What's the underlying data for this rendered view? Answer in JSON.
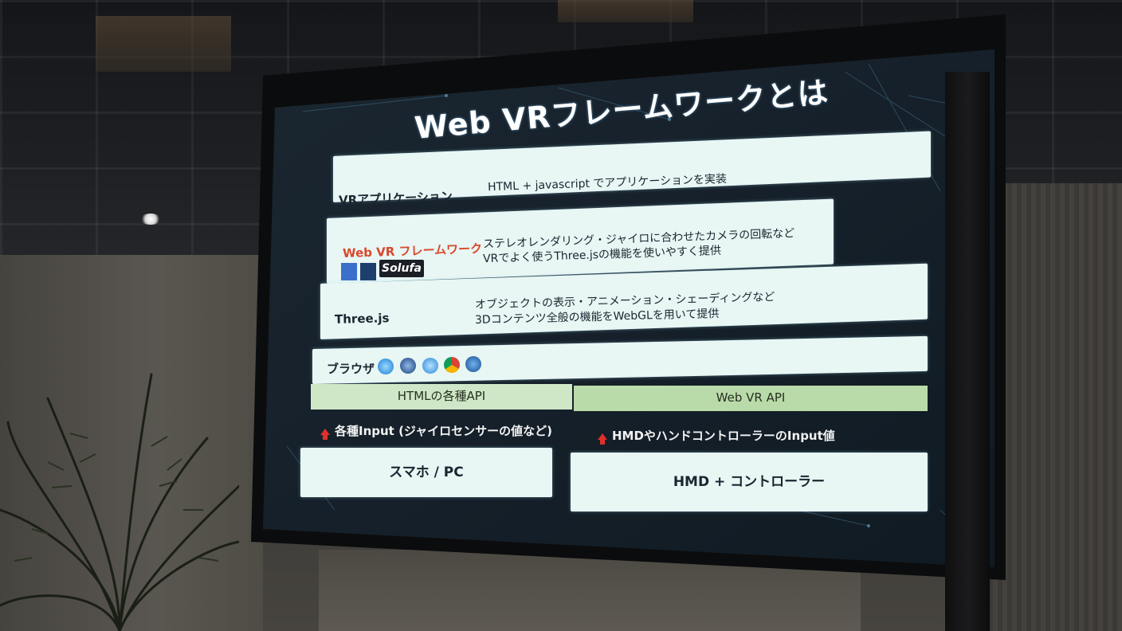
{
  "slide": {
    "title": "Web VRフレームワークとは",
    "layers": [
      {
        "label": "VRアプリケーション",
        "desc": [
          "HTML + javascript でアプリケーションを実装"
        ]
      },
      {
        "label": "Web VR フレームワーク",
        "desc": [
          "ステレオレンダリング・ジャイロに合わせたカメラの回転など",
          "VRでよく使うThree.jsの機能を使いやすく提供"
        ],
        "logo_text": "Solufa"
      },
      {
        "label": "Three.js",
        "desc": [
          "オブジェクトの表示・アニメーション・シェーディングなど",
          "3Dコンテンツ全般の機能をWebGLを用いて提供"
        ]
      },
      {
        "label": "ブラウザ"
      }
    ],
    "apis": [
      "HTMLの各種API",
      "Web VR API"
    ],
    "inputs": [
      "各種Input (ジャイロセンサーの値など)",
      "HMDやハンドコントローラーのInput値"
    ],
    "devices": [
      "スマホ / PC",
      "HMD + コントローラー"
    ],
    "colors": {
      "box": "#e8f6f4",
      "api_left": "#cfe7c7",
      "api_right": "#b9dba9",
      "framework_label": "#d9482b",
      "arrow": "#e0302a"
    },
    "browser_icons": [
      "ie-icon",
      "safari-icon",
      "edge-icon",
      "chrome-icon",
      "firefox-icon"
    ],
    "framework_icons": [
      "threejs-icon",
      "react-icon"
    ]
  }
}
